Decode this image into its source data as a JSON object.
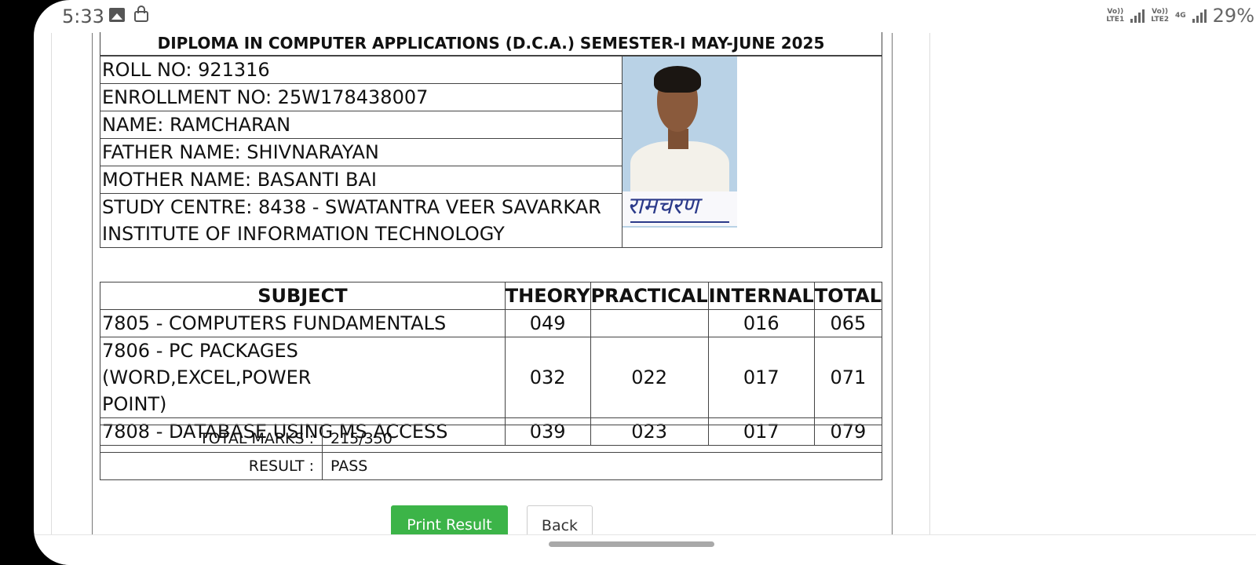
{
  "status_bar": {
    "time": "5:33",
    "sim1_label_top": "Vo))",
    "sim1_label_bottom": "LTE1",
    "sim2_label_top": "Vo))",
    "sim2_label_bottom": "LTE2",
    "net_type": "4G",
    "battery": "29%",
    "icons": [
      "gallery-icon",
      "lock-icon",
      "signal-icon",
      "battery-icon"
    ]
  },
  "heading": "DIPLOMA IN COMPUTER APPLICATIONS (D.C.A.) SEMESTER-I MAY-JUNE 2025",
  "student": {
    "roll_no": "ROLL NO: 921316",
    "enrollment_no": "ENROLLMENT NO: 25W178438007",
    "name": "NAME: RAMCHARAN",
    "father_name": "FATHER NAME: SHIVNARAYAN",
    "mother_name": "MOTHER NAME: BASANTI BAI",
    "study_centre_line1": "STUDY CENTRE: 8438 - SWATANTRA VEER SAVARKAR",
    "study_centre_line2": "INSTITUTE OF INFORMATION TECHNOLOGY",
    "signature": "रामचरण"
  },
  "marks": {
    "headers": [
      "SUBJECT",
      "THEORY",
      "PRACTICAL",
      "INTERNAL",
      "TOTAL"
    ],
    "rows": [
      {
        "subject": "7805  - COMPUTERS FUNDAMENTALS",
        "subject_line2": "",
        "theory": "049",
        "practical": "",
        "internal": "016",
        "total": "065"
      },
      {
        "subject": "7806  - PC PACKAGES (WORD,EXCEL,POWER",
        "subject_line2": "POINT)",
        "theory": "032",
        "practical": "022",
        "internal": "017",
        "total": "071"
      },
      {
        "subject": "7808  - DATABASE USING MS ACCESS",
        "subject_line2": "",
        "theory": "039",
        "practical": "023",
        "internal": "017",
        "total": "079"
      }
    ]
  },
  "summary": {
    "total_label": "TOTAL MARKS :",
    "total_value": "215/350",
    "result_label": "RESULT :",
    "result_value": "PASS"
  },
  "buttons": {
    "print": "Print Result",
    "back": "Back"
  },
  "colors": {
    "print_button": "#3cb448",
    "text": "#111111",
    "border": "#444444"
  }
}
